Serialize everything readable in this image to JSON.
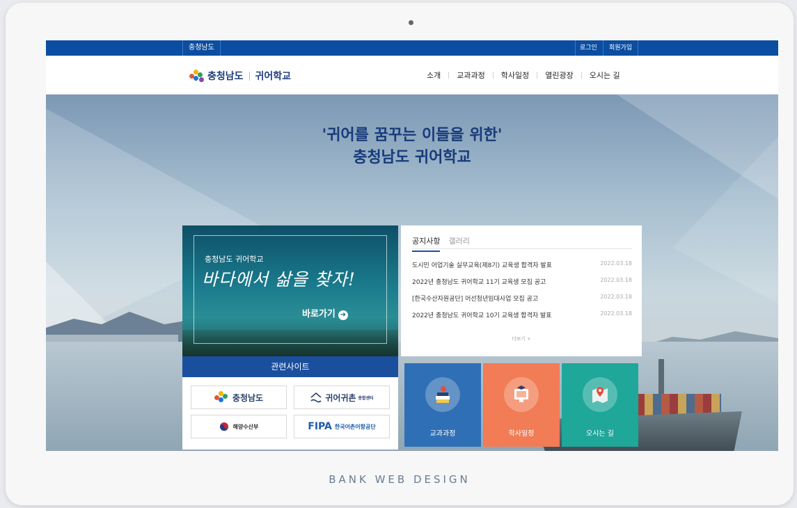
{
  "topbar": {
    "region": "충청남도",
    "login": "로그인",
    "join": "회원가입"
  },
  "header": {
    "logo_org": "충청남도",
    "logo_school": "귀어학교",
    "nav": [
      "소개",
      "교과과정",
      "학사일정",
      "열린광장",
      "오시는 길"
    ]
  },
  "hero": {
    "line1": "'귀어를 꿈꾸는 이들을 위한'",
    "line2": "충청남도 귀어학교"
  },
  "promo": {
    "subtitle": "충청남도 귀어학교",
    "slogan": "바다에서 삶을 찾자!",
    "cta": "바로가기"
  },
  "notice": {
    "tabs": [
      "공지사항",
      "갤러리"
    ],
    "items": [
      {
        "title": "도시민 어업기술 실무교육(제8기) 교육생 합격자 발표",
        "date": "2022.03.18"
      },
      {
        "title": "2022년 충청남도 귀어학교 11기 교육생 모집 공고",
        "date": "2022.03.18"
      },
      {
        "title": "[한국수산자원공단] 어선청년임대사업 모집 공고",
        "date": "2022.03.18"
      },
      {
        "title": "2022년 충청남도 귀어학교 10기 교육생 합격자 발표",
        "date": "2022.03.18"
      }
    ],
    "more": "더보기 +"
  },
  "related": {
    "heading": "관련사이트",
    "sites": {
      "chungnam": "충청남도",
      "gwieo": "귀어귀촌",
      "gwieo_tag": "종합센터",
      "mof": "해양수산부",
      "fipa": "FIPA",
      "fipa_name": "한국어촌어항공단"
    }
  },
  "tiles": [
    {
      "label": "교과과정",
      "color": "#2f6fb5",
      "icon": "books-icon"
    },
    {
      "label": "학사일정",
      "color": "#f27c55",
      "icon": "calendar-monitor-icon"
    },
    {
      "label": "오시는 길",
      "color": "#1fa79a",
      "icon": "map-pin-icon"
    }
  ],
  "footer": {
    "brand": "BANK WEB DESIGN"
  }
}
